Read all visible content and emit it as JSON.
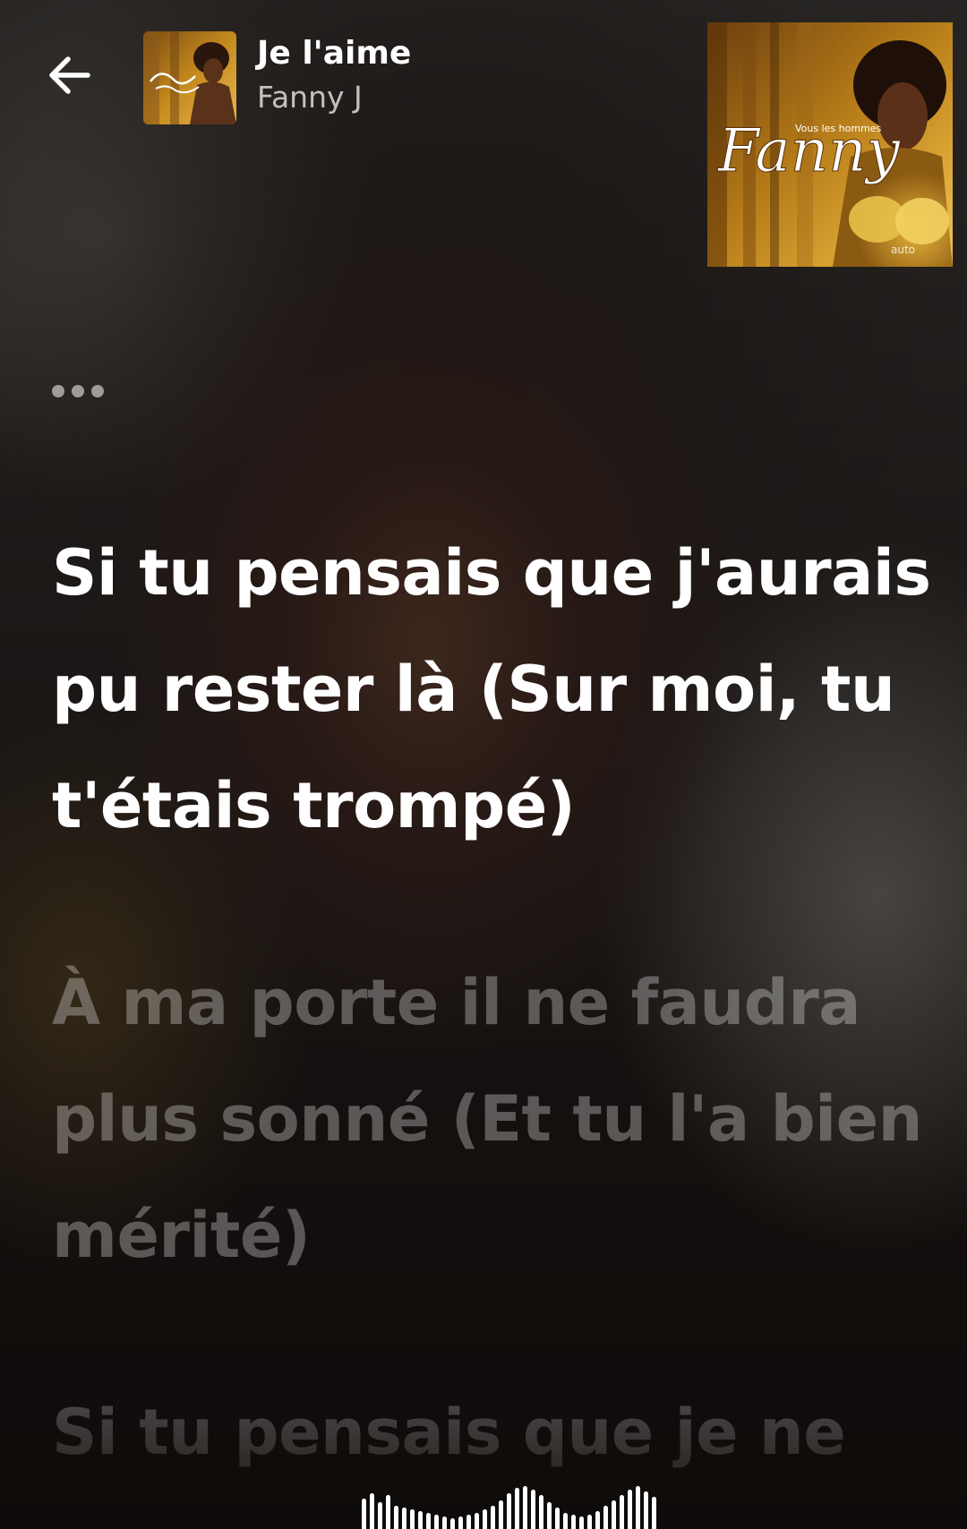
{
  "header": {
    "back_icon": "arrow-left-icon",
    "track_title": "Je l'aime",
    "artist": "Fanny J"
  },
  "album_cover": {
    "script_text": "Fanny",
    "subtitle_text": "Vous les hommes"
  },
  "lyrics": {
    "previous_indicator": "ellipsis-icon",
    "current_line": "Si tu pensais que j'aurais pu rester là (Sur moi, tu t'étais trompé)",
    "next_line": "À ma porte il ne faudra plus sonné (Et tu l'a bien mérité)",
    "faded_line": "Si tu pensais que je ne"
  },
  "waveform_icon": "audio-waveform-icon",
  "colors": {
    "text_primary": "#ffffff",
    "text_dim": "rgba(255,255,255,0.30)",
    "cover_gold": "#c8951e"
  }
}
